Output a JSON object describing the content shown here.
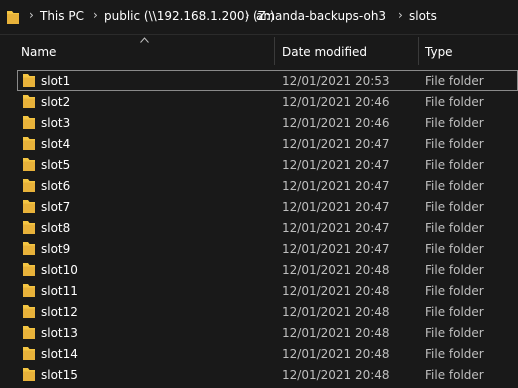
{
  "address_bar": {
    "icon": "folder-icon",
    "separator": "›",
    "crumbs": [
      "This PC",
      "public (\\\\192.168.1.200) (Z:)",
      "amanda-backups-oh3",
      "slots"
    ]
  },
  "columns": {
    "name": "Name",
    "date": "Date modified",
    "type": "Type",
    "sorted_by": "name",
    "sort_direction": "ascending"
  },
  "colors": {
    "background": "#191919",
    "folder": "#f4c542",
    "text": "#ffffff",
    "secondary_text": "#bfbfbf"
  },
  "files": [
    {
      "name": "slot1",
      "date": "12/01/2021 20:53",
      "type": "File folder",
      "focused": true
    },
    {
      "name": "slot2",
      "date": "12/01/2021 20:46",
      "type": "File folder"
    },
    {
      "name": "slot3",
      "date": "12/01/2021 20:46",
      "type": "File folder"
    },
    {
      "name": "slot4",
      "date": "12/01/2021 20:47",
      "type": "File folder"
    },
    {
      "name": "slot5",
      "date": "12/01/2021 20:47",
      "type": "File folder"
    },
    {
      "name": "slot6",
      "date": "12/01/2021 20:47",
      "type": "File folder"
    },
    {
      "name": "slot7",
      "date": "12/01/2021 20:47",
      "type": "File folder"
    },
    {
      "name": "slot8",
      "date": "12/01/2021 20:47",
      "type": "File folder"
    },
    {
      "name": "slot9",
      "date": "12/01/2021 20:47",
      "type": "File folder"
    },
    {
      "name": "slot10",
      "date": "12/01/2021 20:48",
      "type": "File folder"
    },
    {
      "name": "slot11",
      "date": "12/01/2021 20:48",
      "type": "File folder"
    },
    {
      "name": "slot12",
      "date": "12/01/2021 20:48",
      "type": "File folder"
    },
    {
      "name": "slot13",
      "date": "12/01/2021 20:48",
      "type": "File folder"
    },
    {
      "name": "slot14",
      "date": "12/01/2021 20:48",
      "type": "File folder"
    },
    {
      "name": "slot15",
      "date": "12/01/2021 20:48",
      "type": "File folder"
    }
  ]
}
